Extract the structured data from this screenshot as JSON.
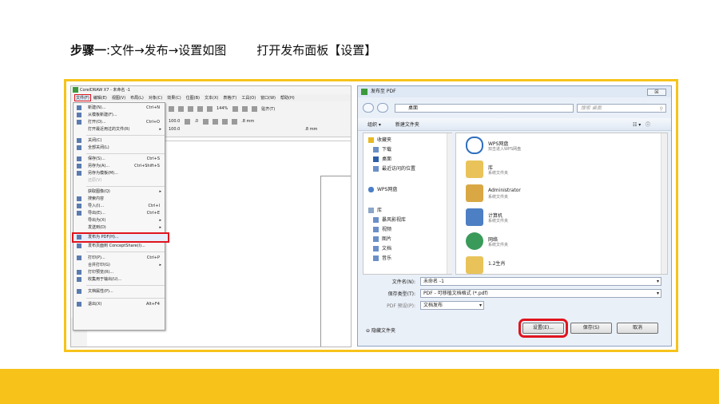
{
  "heading": {
    "step_label": "步骤一",
    "step_text": ":文件→发布→设置如图",
    "instruction": "打开发布面板【设置】"
  },
  "colors": {
    "accent": "#f7c31a",
    "highlight_box": "#e0141e"
  },
  "coreldraw": {
    "title": "CorelDRAW X7 - 未命名 -1",
    "menu": [
      "文件(F)",
      "编辑(E)",
      "视图(V)",
      "布局(L)",
      "对象(C)",
      "效果(C)",
      "位图(B)",
      "文本(X)",
      "表格(T)",
      "工具(O)",
      "窗口(W)",
      "帮助(H)"
    ],
    "toolbar": {
      "zoom": "144%",
      "size1": "100.0",
      "size2": "100.0",
      "angle": ".0",
      "nudge1": ".8 mm",
      "nudge2": ".8 mm",
      "snap": "贴齐(T)"
    },
    "file_menu": [
      {
        "label": "新建(N)...",
        "shortcut": "Ctrl+N"
      },
      {
        "label": "从模板新建(F)...",
        "shortcut": ""
      },
      {
        "label": "打开(O)...",
        "shortcut": "Ctrl+O"
      },
      {
        "label": "打开最近用过的文件(R)",
        "shortcut": ""
      },
      {
        "label": "关闭(C)",
        "shortcut": ""
      },
      {
        "label": "全部关闭(L)",
        "shortcut": ""
      },
      {
        "label": "保存(S)...",
        "shortcut": "Ctrl+S"
      },
      {
        "label": "另存为(A)...",
        "shortcut": "Ctrl+Shift+S"
      },
      {
        "label": "另存为模板(M)...",
        "shortcut": ""
      },
      {
        "label": "还原(V)",
        "shortcut": ""
      },
      {
        "label": "获取图像(Q)",
        "shortcut": ""
      },
      {
        "label": "搜索内容",
        "shortcut": ""
      },
      {
        "label": "导入(I)...",
        "shortcut": "Ctrl+I"
      },
      {
        "label": "导出(E)...",
        "shortcut": "Ctrl+E"
      },
      {
        "label": "导出为(X)",
        "shortcut": ""
      },
      {
        "label": "发送到(D)",
        "shortcut": ""
      },
      {
        "label": "发布为 PDF(H)...",
        "shortcut": ""
      },
      {
        "label": "发布页面到 ConceptShare(I)...",
        "shortcut": ""
      },
      {
        "label": "打印(P)...",
        "shortcut": "Ctrl+P"
      },
      {
        "label": "合并打印(G)",
        "shortcut": ""
      },
      {
        "label": "打印预览(R)...",
        "shortcut": ""
      },
      {
        "label": "收集用于输出(U)...",
        "shortcut": ""
      },
      {
        "label": "文档属性(P)...",
        "shortcut": ""
      },
      {
        "label": "退出(X)",
        "shortcut": "Alt+F4"
      }
    ]
  },
  "dialog": {
    "title": "发布至 PDF",
    "close": "☒",
    "address": "桌面",
    "search_placeholder": "搜索 桌面",
    "organize": "组织 ▾",
    "new_folder": "新建文件夹",
    "nav": [
      "收藏夹",
      "下载",
      "桌面",
      "最近访问的位置",
      "WPS网盘",
      "库",
      "暴风影视库",
      "视频",
      "图片",
      "文档",
      "音乐"
    ],
    "files": [
      {
        "name": "WPS网盘",
        "desc": "双击进入WPS网盘"
      },
      {
        "name": "库",
        "desc": "系统文件夹"
      },
      {
        "name": "Administrator",
        "desc": "系统文件夹"
      },
      {
        "name": "计算机",
        "desc": "系统文件夹"
      },
      {
        "name": "网络",
        "desc": "系统文件夹"
      },
      {
        "name": "1.2生肖",
        "desc": ""
      }
    ],
    "filename_label": "文件名(N):",
    "filename_value": "未命名 -1",
    "filetype_label": "保存类型(T):",
    "filetype_value": "PDF - 可移植文档格式 (*.pdf)",
    "preset_label": "PDF 预设(P):",
    "preset_value": "文档发布",
    "hide_folders": "隐藏文件夹",
    "settings_button": "设置(E)...",
    "save_button": "保存(S)",
    "cancel_button": "取消"
  }
}
